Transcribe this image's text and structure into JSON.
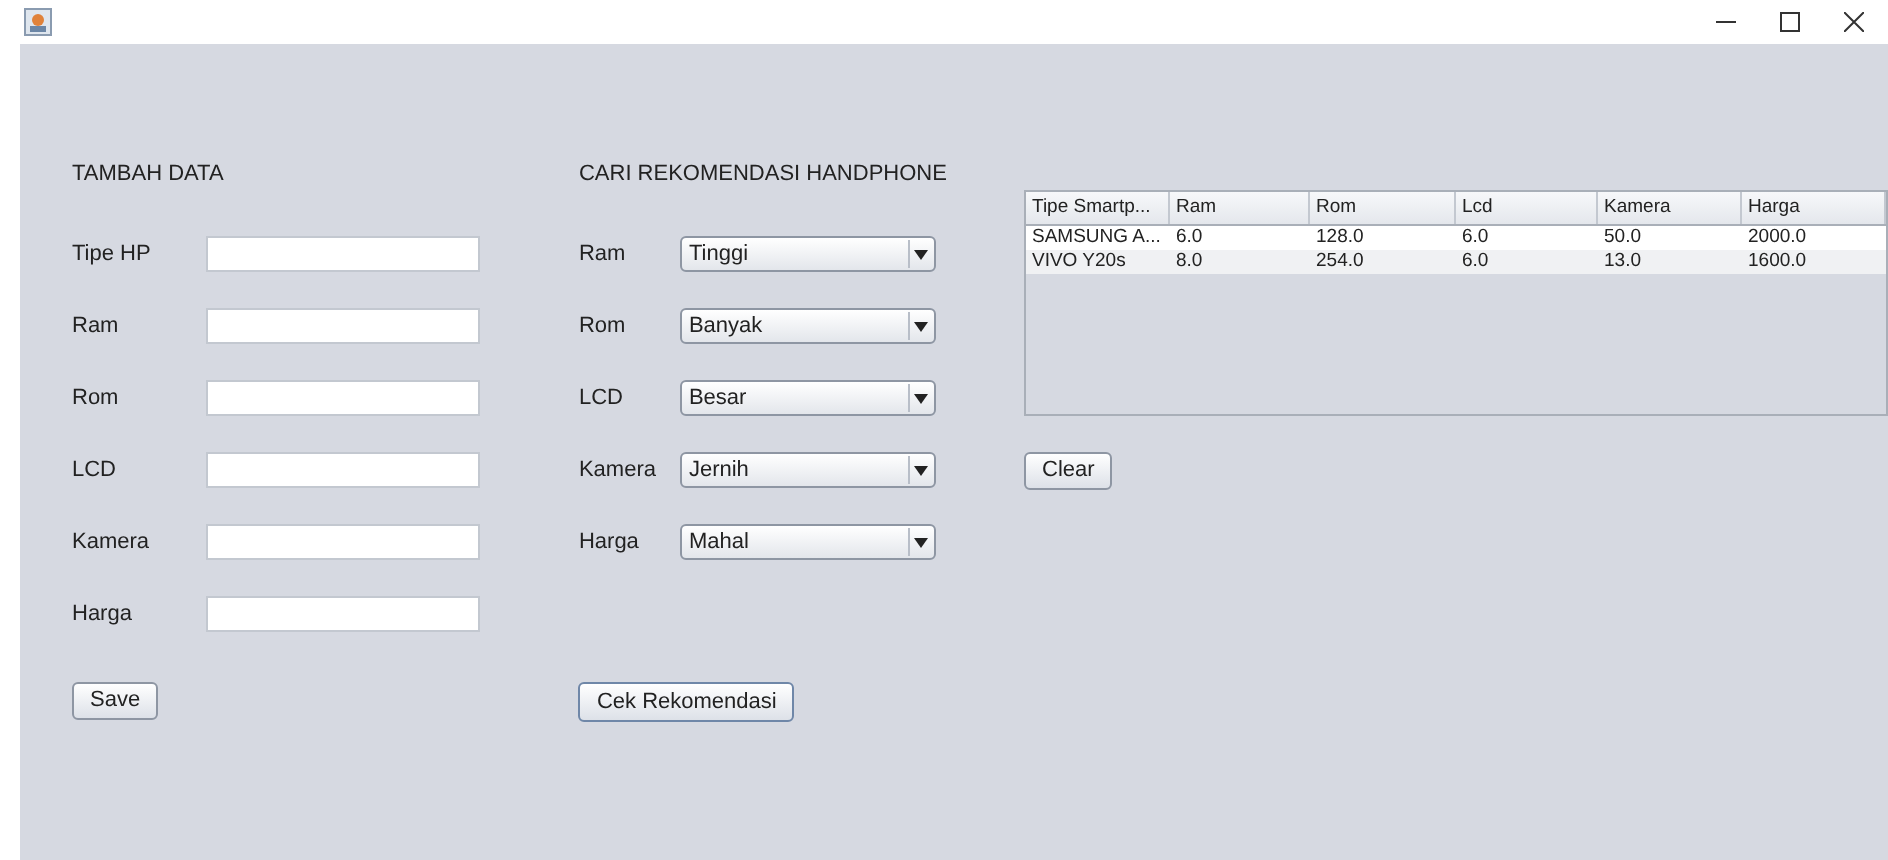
{
  "tambah_data": {
    "title": "TAMBAH DATA",
    "fields": [
      {
        "label": "Tipe HP"
      },
      {
        "label": "Ram"
      },
      {
        "label": "Rom"
      },
      {
        "label": "LCD"
      },
      {
        "label": "Kamera"
      },
      {
        "label": "Harga"
      }
    ],
    "button": "Save"
  },
  "cari_rekomendasi": {
    "title": "CARI REKOMENDASI HANDPHONE",
    "fields": [
      {
        "label": "Ram",
        "value": "Tinggi"
      },
      {
        "label": "Rom",
        "value": "Banyak"
      },
      {
        "label": "LCD",
        "value": "Besar"
      },
      {
        "label": "Kamera",
        "value": "Jernih"
      },
      {
        "label": "Harga",
        "value": "Mahal"
      }
    ],
    "button": "Cek Rekomendasi"
  },
  "table": {
    "columns": [
      "Tipe Smartp...",
      "Ram",
      "Rom",
      "Lcd",
      "Kamera",
      "Harga"
    ],
    "rows": [
      [
        "SAMSUNG A...",
        "6.0",
        "128.0",
        "6.0",
        "50.0",
        "2000.0"
      ],
      [
        "VIVO Y20s",
        "8.0",
        "254.0",
        "6.0",
        "13.0",
        "1600.0"
      ]
    ]
  },
  "clear_button": "Clear"
}
